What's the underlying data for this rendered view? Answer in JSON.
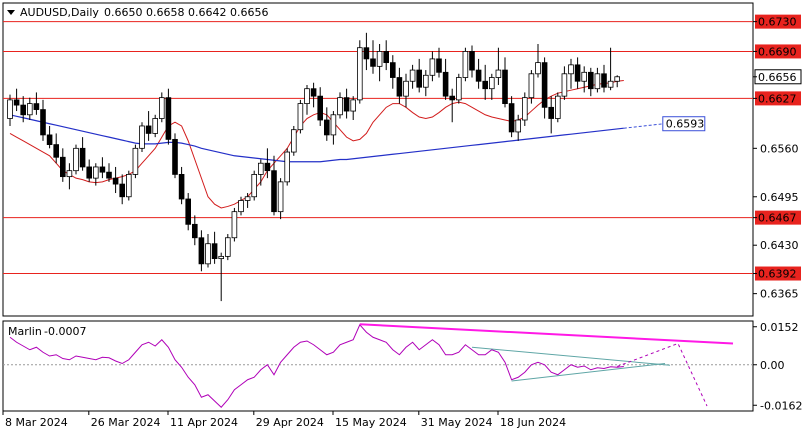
{
  "chart_data": [
    {
      "type": "candlestick",
      "symbol": "AUDUSD",
      "timeframe": "Daily",
      "header": {
        "symbol_tf": "AUDUSD,Daily",
        "ohlc": "0.6650 0.6658 0.6642 0.6656"
      },
      "ylim": [
        0.6335,
        0.6755
      ],
      "y_ticks": [
        "0.6730",
        "0.6690",
        "0.6656",
        "0.6627",
        "0.6560",
        "0.6495",
        "0.6467",
        "0.6430",
        "0.6392",
        "0.6365"
      ],
      "x_ticks": [
        "8 Mar 2024",
        "26 Mar 2024",
        "11 Apr 2024",
        "29 Apr 2024",
        "15 May 2024",
        "31 May 2024",
        "18 Jun 2024"
      ],
      "levels": [
        {
          "value": 0.673,
          "label": "0.6730",
          "color": "#e8231e"
        },
        {
          "value": 0.669,
          "label": "0.6690",
          "color": "#e8231e"
        },
        {
          "value": 0.6627,
          "label": "0.6627",
          "color": "#e8231e"
        },
        {
          "value": 0.6467,
          "label": "0.6467",
          "color": "#e8231e"
        },
        {
          "value": 0.6392,
          "label": "0.6392",
          "color": "#e8231e"
        }
      ],
      "current_price": {
        "value": 0.6656,
        "label": "0.6656"
      },
      "ma_projection": {
        "value": 0.6593,
        "label": "0.6593",
        "color": "#3a4fd8"
      },
      "candles": [
        [
          0.66,
          0.6632,
          0.659,
          0.6625
        ],
        [
          0.6625,
          0.664,
          0.661,
          0.6618
        ],
        [
          0.6618,
          0.663,
          0.6595,
          0.6605
        ],
        [
          0.6605,
          0.6628,
          0.6598,
          0.662
        ],
        [
          0.662,
          0.6635,
          0.6605,
          0.6612
        ],
        [
          0.6612,
          0.6625,
          0.657,
          0.6578
        ],
        [
          0.6578,
          0.659,
          0.656,
          0.6565
        ],
        [
          0.6565,
          0.658,
          0.654,
          0.6548
        ],
        [
          0.6548,
          0.656,
          0.6515,
          0.6522
        ],
        [
          0.6522,
          0.654,
          0.6505,
          0.653
        ],
        [
          0.653,
          0.6565,
          0.6525,
          0.656
        ],
        [
          0.656,
          0.6575,
          0.653,
          0.6535
        ],
        [
          0.6535,
          0.6545,
          0.6515,
          0.652
        ],
        [
          0.652,
          0.654,
          0.651,
          0.6535
        ],
        [
          0.6535,
          0.6548,
          0.652,
          0.6528
        ],
        [
          0.6528,
          0.654,
          0.6515,
          0.652
        ],
        [
          0.652,
          0.6535,
          0.65,
          0.6512
        ],
        [
          0.6512,
          0.6525,
          0.6485,
          0.6495
        ],
        [
          0.6495,
          0.653,
          0.649,
          0.6525
        ],
        [
          0.6525,
          0.6565,
          0.652,
          0.656
        ],
        [
          0.656,
          0.6595,
          0.6555,
          0.659
        ],
        [
          0.659,
          0.661,
          0.657,
          0.658
        ],
        [
          0.658,
          0.6605,
          0.6575,
          0.66
        ],
        [
          0.66,
          0.6635,
          0.6595,
          0.6628
        ],
        [
          0.6628,
          0.664,
          0.6565,
          0.6572
        ],
        [
          0.6572,
          0.658,
          0.652,
          0.6525
        ],
        [
          0.6525,
          0.6535,
          0.6485,
          0.6492
        ],
        [
          0.6492,
          0.65,
          0.645,
          0.6458
        ],
        [
          0.6458,
          0.647,
          0.643,
          0.644
        ],
        [
          0.644,
          0.645,
          0.6395,
          0.6405
        ],
        [
          0.6405,
          0.6445,
          0.64,
          0.6432
        ],
        [
          0.6432,
          0.6448,
          0.6405,
          0.6412
        ],
        [
          0.6412,
          0.642,
          0.6355,
          0.6415
        ],
        [
          0.6415,
          0.6445,
          0.641,
          0.644
        ],
        [
          0.644,
          0.648,
          0.6435,
          0.6475
        ],
        [
          0.6475,
          0.6495,
          0.647,
          0.649
        ],
        [
          0.649,
          0.65,
          0.648,
          0.6495
        ],
        [
          0.6495,
          0.653,
          0.649,
          0.6525
        ],
        [
          0.6525,
          0.6545,
          0.651,
          0.654
        ],
        [
          0.654,
          0.656,
          0.652,
          0.653
        ],
        [
          0.653,
          0.655,
          0.647,
          0.6475
        ],
        [
          0.6475,
          0.652,
          0.6465,
          0.6515
        ],
        [
          0.6515,
          0.656,
          0.651,
          0.6555
        ],
        [
          0.6555,
          0.659,
          0.655,
          0.6585
        ],
        [
          0.6585,
          0.6625,
          0.658,
          0.662
        ],
        [
          0.662,
          0.6645,
          0.6605,
          0.664
        ],
        [
          0.664,
          0.6648,
          0.6615,
          0.663
        ],
        [
          0.663,
          0.6642,
          0.659,
          0.6598
        ],
        [
          0.6598,
          0.6615,
          0.657,
          0.6578
        ],
        [
          0.6578,
          0.661,
          0.6565,
          0.6605
        ],
        [
          0.6605,
          0.6635,
          0.66,
          0.6628
        ],
        [
          0.6628,
          0.664,
          0.66,
          0.661
        ],
        [
          0.661,
          0.663,
          0.6598,
          0.6625
        ],
        [
          0.6625,
          0.6705,
          0.662,
          0.6695
        ],
        [
          0.6695,
          0.6715,
          0.6665,
          0.668
        ],
        [
          0.668,
          0.6705,
          0.666,
          0.667
        ],
        [
          0.667,
          0.67,
          0.665,
          0.669
        ],
        [
          0.669,
          0.6705,
          0.6665,
          0.6675
        ],
        [
          0.6675,
          0.6685,
          0.664,
          0.6655
        ],
        [
          0.6655,
          0.6668,
          0.662,
          0.663
        ],
        [
          0.663,
          0.666,
          0.6615,
          0.665
        ],
        [
          0.665,
          0.6672,
          0.664,
          0.6665
        ],
        [
          0.6665,
          0.668,
          0.6635,
          0.6642
        ],
        [
          0.6642,
          0.6665,
          0.663,
          0.6658
        ],
        [
          0.6658,
          0.669,
          0.665,
          0.668
        ],
        [
          0.668,
          0.6695,
          0.6655,
          0.6662
        ],
        [
          0.6662,
          0.668,
          0.6625,
          0.663
        ],
        [
          0.663,
          0.664,
          0.6595,
          0.6625
        ],
        [
          0.6625,
          0.666,
          0.662,
          0.6655
        ],
        [
          0.6655,
          0.6695,
          0.665,
          0.669
        ],
        [
          0.669,
          0.6698,
          0.6655,
          0.6665
        ],
        [
          0.6665,
          0.668,
          0.664,
          0.665
        ],
        [
          0.665,
          0.6672,
          0.6625,
          0.664
        ],
        [
          0.664,
          0.666,
          0.6625,
          0.6655
        ],
        [
          0.6655,
          0.6695,
          0.6645,
          0.6665
        ],
        [
          0.6665,
          0.6682,
          0.6615,
          0.662
        ],
        [
          0.662,
          0.663,
          0.6575,
          0.6582
        ],
        [
          0.6582,
          0.6605,
          0.657,
          0.6598
        ],
        [
          0.6598,
          0.6635,
          0.659,
          0.6628
        ],
        [
          0.6628,
          0.6665,
          0.662,
          0.666
        ],
        [
          0.666,
          0.67,
          0.6655,
          0.6675
        ],
        [
          0.6675,
          0.6682,
          0.66,
          0.6615
        ],
        [
          0.6615,
          0.663,
          0.658,
          0.66
        ],
        [
          0.66,
          0.6635,
          0.6595,
          0.663
        ],
        [
          0.663,
          0.667,
          0.6625,
          0.666
        ],
        [
          0.666,
          0.668,
          0.664,
          0.6672
        ],
        [
          0.6672,
          0.6682,
          0.664,
          0.665
        ],
        [
          0.665,
          0.667,
          0.6635,
          0.6662
        ],
        [
          0.6662,
          0.6668,
          0.663,
          0.664
        ],
        [
          0.664,
          0.6668,
          0.6635,
          0.666
        ],
        [
          0.666,
          0.6672,
          0.6635,
          0.6642
        ],
        [
          0.6642,
          0.6695,
          0.6638,
          0.665
        ],
        [
          0.665,
          0.6658,
          0.6642,
          0.6656
        ]
      ],
      "ma_red": [
        0.658,
        0.6575,
        0.657,
        0.6565,
        0.656,
        0.6555,
        0.655,
        0.654,
        0.653,
        0.6525,
        0.652,
        0.6518,
        0.6515,
        0.6514,
        0.6515,
        0.6518,
        0.652,
        0.6522,
        0.6525,
        0.653,
        0.654,
        0.655,
        0.656,
        0.6575,
        0.659,
        0.6595,
        0.659,
        0.657,
        0.6545,
        0.652,
        0.6495,
        0.6485,
        0.648,
        0.6482,
        0.6485,
        0.649,
        0.6495,
        0.6505,
        0.6515,
        0.653,
        0.654,
        0.655,
        0.656,
        0.6575,
        0.659,
        0.66,
        0.6605,
        0.6608,
        0.6605,
        0.6595,
        0.6585,
        0.6575,
        0.657,
        0.6572,
        0.658,
        0.6595,
        0.6605,
        0.6615,
        0.662,
        0.662,
        0.6615,
        0.6608,
        0.6602,
        0.66,
        0.6602,
        0.6608,
        0.6615,
        0.662,
        0.6622,
        0.662,
        0.6615,
        0.661,
        0.6605,
        0.6602,
        0.66,
        0.6598,
        0.6596,
        0.6598,
        0.6602,
        0.661,
        0.6618,
        0.6625,
        0.663,
        0.6634,
        0.6636,
        0.6638,
        0.664,
        0.6642,
        0.6644,
        0.6646,
        0.6647,
        0.6648,
        0.665,
        0.6651
      ],
      "ma_blue": [
        0.6605,
        0.6603,
        0.6601,
        0.6599,
        0.6597,
        0.6595,
        0.6593,
        0.6591,
        0.6589,
        0.6587,
        0.6585,
        0.6583,
        0.6581,
        0.6579,
        0.6577,
        0.6575,
        0.6573,
        0.6571,
        0.6569,
        0.6567,
        0.6566,
        0.6566,
        0.6566,
        0.6567,
        0.6568,
        0.6568,
        0.6567,
        0.6565,
        0.6563,
        0.656,
        0.6558,
        0.6556,
        0.6554,
        0.6552,
        0.655,
        0.6549,
        0.6548,
        0.6547,
        0.6546,
        0.6545,
        0.6544,
        0.6543,
        0.6542,
        0.6542,
        0.6542,
        0.6542,
        0.6542,
        0.6542,
        0.6543,
        0.6544,
        0.6545,
        0.6545,
        0.6546,
        0.6547,
        0.6548,
        0.6549,
        0.655,
        0.6551,
        0.6552,
        0.6553,
        0.6554,
        0.6555,
        0.6556,
        0.6557,
        0.6558,
        0.6559,
        0.656,
        0.6561,
        0.6562,
        0.6563,
        0.6564,
        0.6565,
        0.6566,
        0.6567,
        0.6568,
        0.6569,
        0.657,
        0.6571,
        0.6572,
        0.6573,
        0.6574,
        0.6575,
        0.6576,
        0.6577,
        0.6578,
        0.6579,
        0.658,
        0.6581,
        0.6582,
        0.6583,
        0.6584,
        0.6585,
        0.6586,
        0.6587
      ]
    },
    {
      "type": "line",
      "title": "Marlin",
      "value_label": "-0.0007",
      "ylim": [
        -0.0185,
        0.0175
      ],
      "y_ticks": [
        "0.0152",
        "0.00",
        "-0.0162"
      ],
      "color": "#b000b8",
      "values": [
        0.011,
        0.009,
        0.0075,
        0.006,
        0.007,
        0.005,
        0.0035,
        0.004,
        0.0025,
        0.002,
        0.0035,
        0.003,
        0.0025,
        0.002,
        0.003,
        0.0028,
        0.0015,
        0.0005,
        0.002,
        0.005,
        0.008,
        0.009,
        0.0075,
        0.01,
        0.007,
        0.002,
        -0.001,
        -0.005,
        -0.008,
        -0.013,
        -0.012,
        -0.0145,
        -0.017,
        -0.014,
        -0.01,
        -0.008,
        -0.006,
        -0.005,
        -0.002,
        0.0,
        -0.004,
        0.001,
        0.004,
        0.007,
        0.009,
        0.0095,
        0.008,
        0.006,
        0.004,
        0.005,
        0.008,
        0.009,
        0.01,
        0.016,
        0.013,
        0.011,
        0.01,
        0.009,
        0.006,
        0.004,
        0.007,
        0.009,
        0.006,
        0.008,
        0.01,
        0.008,
        0.004,
        0.004,
        0.005,
        0.008,
        0.006,
        0.004,
        0.004,
        0.006,
        0.005,
        0.001,
        -0.006,
        -0.005,
        -0.003,
        0.0,
        0.001,
        0.0,
        -0.003,
        -0.004,
        -0.002,
        0.0,
        -0.001,
        -0.0005,
        -0.002,
        -0.0012,
        -0.0015,
        -0.0008,
        -0.001,
        -0.0007
      ]
    }
  ]
}
